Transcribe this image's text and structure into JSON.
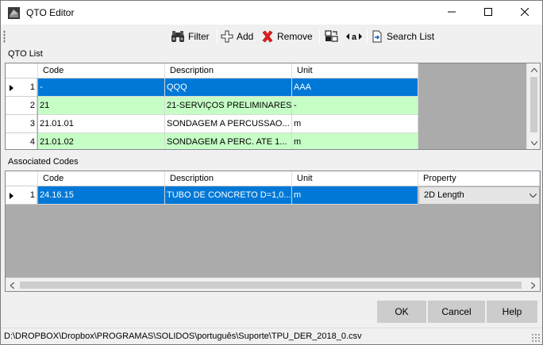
{
  "window": {
    "title": "QTO Editor"
  },
  "toolbar": {
    "filter_label": "Filter",
    "add_label": "Add",
    "remove_label": "Remove",
    "search_list_label": "Search List"
  },
  "qto_list": {
    "section_label": "QTO List",
    "columns": [
      "Code",
      "Description",
      "Unit"
    ],
    "rows": [
      {
        "num": "1",
        "code": "-",
        "description": "QQQ",
        "unit": "AAA",
        "state": "selected"
      },
      {
        "num": "2",
        "code": "21",
        "description": "21-SERVIÇOS PRELIMINARES",
        "unit": "-",
        "state": "green"
      },
      {
        "num": "3",
        "code": "21.01.01",
        "description": "SONDAGEM A PERCUSSAO...",
        "unit": "m",
        "state": "white"
      },
      {
        "num": "4",
        "code": "21.01.02",
        "description": "SONDAGEM A PERC. ATE 1...",
        "unit": "m",
        "state": "green"
      }
    ]
  },
  "associated_codes": {
    "section_label": "Associated Codes",
    "columns": [
      "Code",
      "Description",
      "Unit",
      "Property"
    ],
    "rows": [
      {
        "num": "1",
        "code": "24.16.15",
        "description": "TUBO DE CONCRETO D=1,0...",
        "unit": "m",
        "property": "2D Length",
        "state": "selected"
      }
    ]
  },
  "buttons": {
    "ok": "OK",
    "cancel": "Cancel",
    "help": "Help"
  },
  "status": {
    "path": "D:\\DROPBOX\\Dropbox\\PROGRAMAS\\SOLIDOS\\português\\Suporte\\TPU_DER_2018_0.csv"
  },
  "colors": {
    "selection": "#0078d7",
    "row_highlight": "#c6ffc6",
    "grid_background": "#ababab",
    "button": "#cccccc"
  },
  "icons": [
    "app-icon",
    "minimize-icon",
    "maximize-icon",
    "close-icon",
    "binoculars-icon",
    "add-icon",
    "remove-icon",
    "copy-icon",
    "replace-icon",
    "search-list-icon",
    "chevron-up-icon",
    "chevron-down-icon",
    "chevron-left-icon",
    "chevron-right-icon",
    "dropdown-arrow-icon",
    "row-pointer-icon"
  ]
}
